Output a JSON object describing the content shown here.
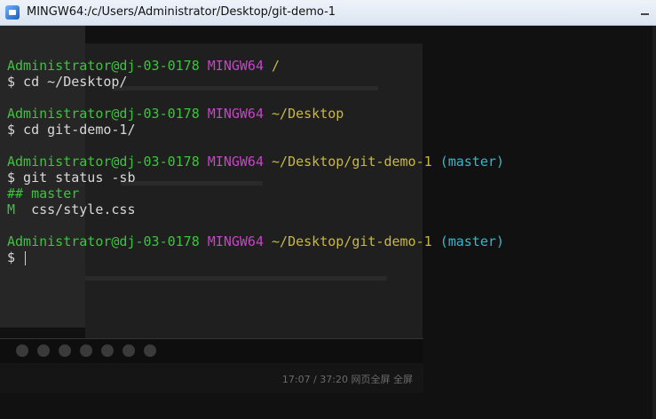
{
  "window": {
    "title": "MINGW64:/c/Users/Administrator/Desktop/git-demo-1",
    "icon": "mingw-terminal-icon"
  },
  "background_overlay": {
    "time": "17:07 / 37:20  网页全屏  全屏"
  },
  "terminal": {
    "prompt_1": {
      "user": "Administrator@dj-03-0178",
      "system": "MINGW64",
      "path": "/",
      "command": "$ cd ~/Desktop/"
    },
    "prompt_2": {
      "user": "Administrator@dj-03-0178",
      "system": "MINGW64",
      "path": "~/Desktop",
      "command": "$ cd git-demo-1/"
    },
    "prompt_3": {
      "user": "Administrator@dj-03-0178",
      "system": "MINGW64",
      "path": "~/Desktop/git-demo-1",
      "branch": "(master)",
      "command": "$ git status -sb"
    },
    "output": {
      "branch_line": "## master",
      "status_code": "M",
      "file": "  css/style.css"
    },
    "prompt_4": {
      "user": "Administrator@dj-03-0178",
      "system": "MINGW64",
      "path": "~/Desktop/git-demo-1",
      "branch": "(master)",
      "command": "$ "
    }
  },
  "colors": {
    "user": "#3cc43c",
    "system": "#c843c8",
    "path": "#c9b840",
    "branch": "#36b8c9"
  }
}
